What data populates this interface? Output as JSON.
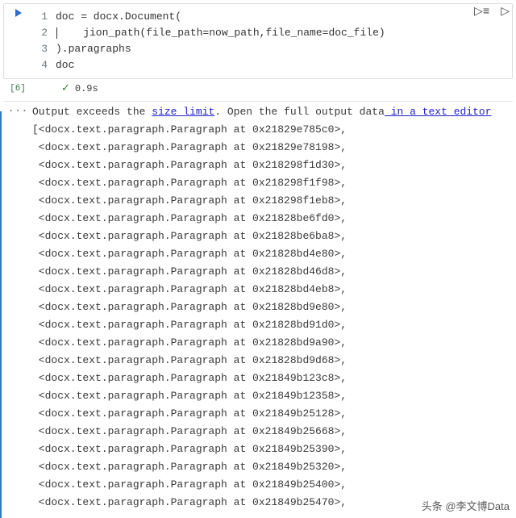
{
  "cell": {
    "exec_label": "[6]",
    "lines": [
      {
        "num": "1",
        "text": "doc = docx.Document("
      },
      {
        "num": "2",
        "text": "    jion_path(file_path=now_path,file_name=doc_file)"
      },
      {
        "num": "3",
        "text": ").paragraphs"
      },
      {
        "num": "4",
        "text": "doc"
      }
    ],
    "status": {
      "icon": "✓",
      "time": "0.9s"
    }
  },
  "output": {
    "prefix": "Output exceeds the ",
    "link1": "size limit",
    "middle": ". Open the full output data",
    "link2": " in a text editor",
    "lines": [
      "[<docx.text.paragraph.Paragraph at 0x21829e785c0>,",
      " <docx.text.paragraph.Paragraph at 0x21829e78198>,",
      " <docx.text.paragraph.Paragraph at 0x218298f1d30>,",
      " <docx.text.paragraph.Paragraph at 0x218298f1f98>,",
      " <docx.text.paragraph.Paragraph at 0x218298f1eb8>,",
      " <docx.text.paragraph.Paragraph at 0x21828be6fd0>,",
      " <docx.text.paragraph.Paragraph at 0x21828be6ba8>,",
      " <docx.text.paragraph.Paragraph at 0x21828bd4e80>,",
      " <docx.text.paragraph.Paragraph at 0x21828bd46d8>,",
      " <docx.text.paragraph.Paragraph at 0x21828bd4eb8>,",
      " <docx.text.paragraph.Paragraph at 0x21828bd9e80>,",
      " <docx.text.paragraph.Paragraph at 0x21828bd91d0>,",
      " <docx.text.paragraph.Paragraph at 0x21828bd9a90>,",
      " <docx.text.paragraph.Paragraph at 0x21828bd9d68>,",
      " <docx.text.paragraph.Paragraph at 0x21849b123c8>,",
      " <docx.text.paragraph.Paragraph at 0x21849b12358>,",
      " <docx.text.paragraph.Paragraph at 0x21849b25128>,",
      " <docx.text.paragraph.Paragraph at 0x21849b25668>,",
      " <docx.text.paragraph.Paragraph at 0x21849b25390>,",
      " <docx.text.paragraph.Paragraph at 0x21849b25320>,",
      " <docx.text.paragraph.Paragraph at 0x21849b25400>,",
      " <docx.text.paragraph.Paragraph at 0x21849b25470>,"
    ]
  },
  "output_gutter": "···",
  "watermark": "头条 @李文博Data"
}
